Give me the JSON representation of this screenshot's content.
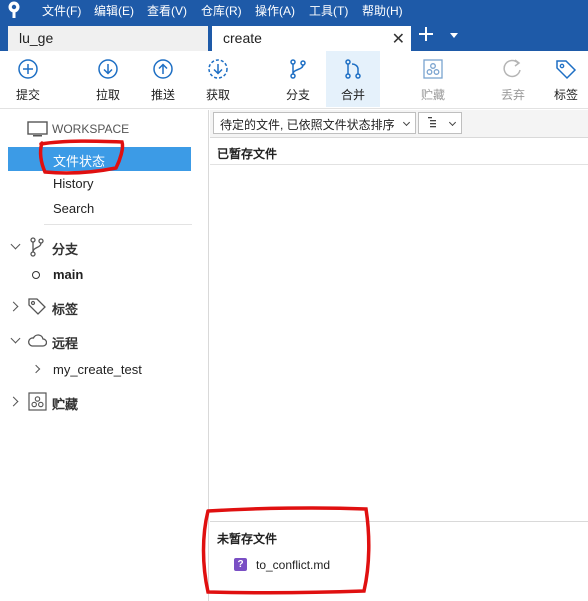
{
  "menu": [
    "文件(F)",
    "编辑(E)",
    "查看(V)",
    "仓库(R)",
    "操作(A)",
    "工具(T)",
    "帮助(H)"
  ],
  "tabs": [
    {
      "label": "lu_ge"
    },
    {
      "label": "create"
    }
  ],
  "toolbar": {
    "commit": "提交",
    "pull": "拉取",
    "push": "推送",
    "fetch": "获取",
    "branch": "分支",
    "merge": "合并",
    "stash": "贮藏",
    "discard": "丢弃",
    "tag": "标签"
  },
  "sidebar": {
    "workspace": "WORKSPACE",
    "file_status": "文件状态",
    "history": "History",
    "search": "Search",
    "branches_header": "分支",
    "current_branch": "main",
    "tags_header": "标签",
    "remotes_header": "远程",
    "remote_name": "my_create_test",
    "stashes_header": "贮藏"
  },
  "content": {
    "sort_combo": "待定的文件, 已依照文件状态排序",
    "staged_header": "已暂存文件",
    "unstaged_header": "未暂存文件",
    "unstaged_files": [
      {
        "name": "to_conflict.md",
        "badge": "?"
      }
    ]
  },
  "colors": {
    "titlebar": "#1e5aa8",
    "selection": "#3c9be6",
    "icon_blue": "#1e6fc4",
    "annotation_red": "#e01010",
    "untracked_badge": "#7a4fc4"
  }
}
